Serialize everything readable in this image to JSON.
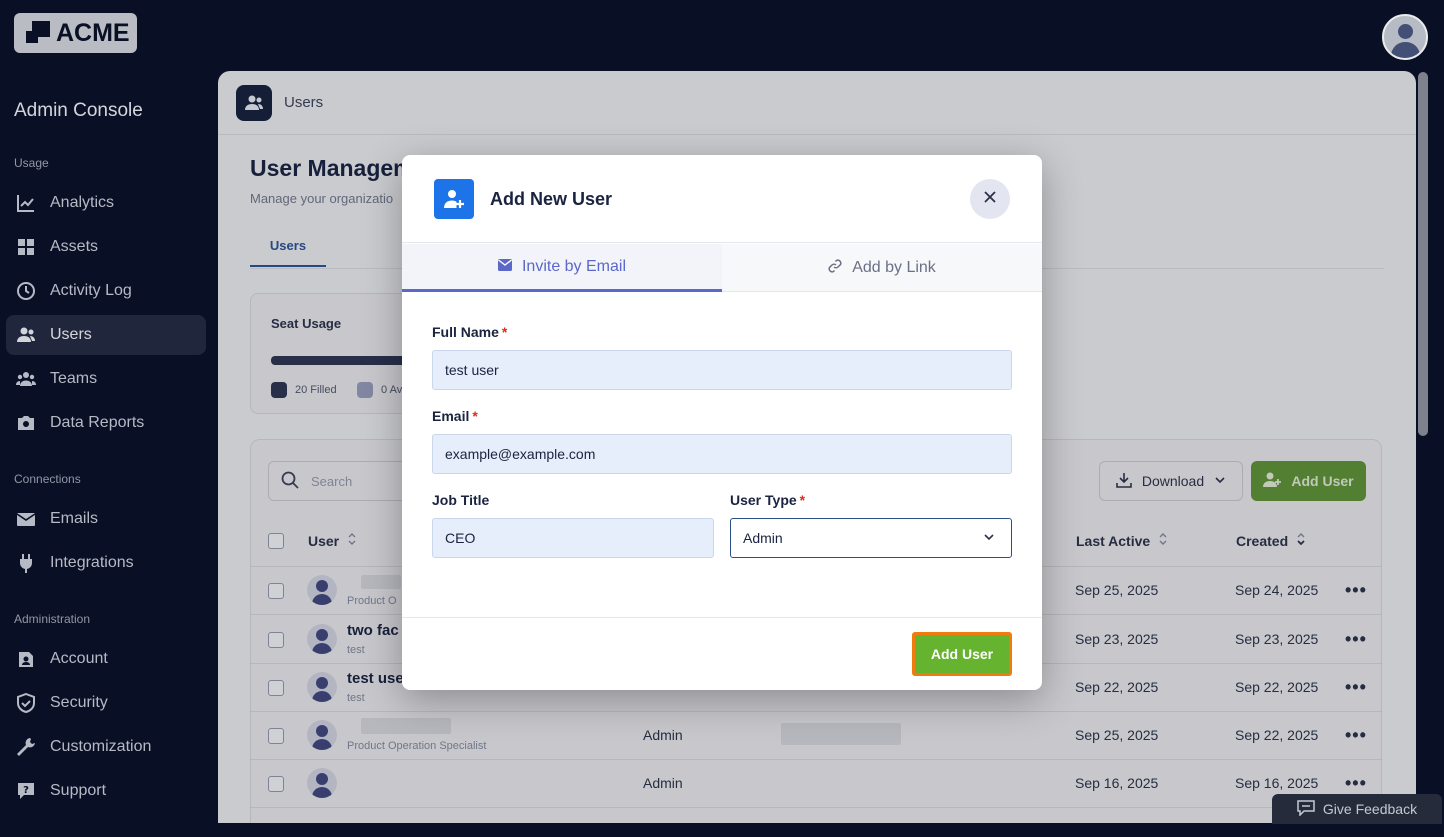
{
  "brand": {
    "logo_text": "ACME"
  },
  "sidebar": {
    "title": "Admin Console",
    "sections": [
      {
        "label": "Usage"
      },
      {
        "label": "Connections"
      },
      {
        "label": "Administration"
      }
    ],
    "items": [
      {
        "label": "Analytics",
        "icon": "analytics-icon"
      },
      {
        "label": "Assets",
        "icon": "assets-icon"
      },
      {
        "label": "Activity Log",
        "icon": "clock-icon"
      },
      {
        "label": "Users",
        "icon": "users-icon",
        "active": true
      },
      {
        "label": "Teams",
        "icon": "teams-icon"
      },
      {
        "label": "Data Reports",
        "icon": "camera-icon"
      },
      {
        "label": "Emails",
        "icon": "mail-icon"
      },
      {
        "label": "Integrations",
        "icon": "plug-icon"
      },
      {
        "label": "Account",
        "icon": "account-icon"
      },
      {
        "label": "Security",
        "icon": "shield-icon"
      },
      {
        "label": "Customization",
        "icon": "wrench-icon"
      },
      {
        "label": "Support",
        "icon": "support-icon"
      }
    ]
  },
  "main": {
    "header_title": "Users",
    "page_title": "User Managem",
    "page_subtitle": "Manage your organizatio",
    "tab_users": "Users",
    "seat": {
      "label": "Seat Usage",
      "filled_label": "20 Filled",
      "available_label": "0 Av"
    },
    "table": {
      "search_placeholder": "Search",
      "download_label": "Download",
      "add_user_label": "Add User",
      "columns": {
        "user": "User",
        "last_active": "Last Active",
        "created": "Created"
      },
      "rows": [
        {
          "name": "",
          "sub": "Product O",
          "role": "",
          "last_active": "Sep 25, 2025",
          "created": "Sep 24, 2025"
        },
        {
          "name": "two fac",
          "sub": "test",
          "role": "",
          "last_active": "Sep 23, 2025",
          "created": "Sep 23, 2025"
        },
        {
          "name": "test use",
          "sub": "test",
          "role": "",
          "last_active": "Sep 22, 2025",
          "created": "Sep 22, 2025"
        },
        {
          "name": "",
          "sub": "Product Operation Specialist",
          "role": "Admin",
          "last_active": "Sep 25, 2025",
          "created": "Sep 22, 2025"
        },
        {
          "name": "",
          "sub": "",
          "role": "Admin",
          "last_active": "Sep 16, 2025",
          "created": "Sep 16, 2025"
        }
      ],
      "more_label": "•••"
    }
  },
  "feedback": {
    "label": "Give Feedback"
  },
  "modal": {
    "title": "Add New User",
    "tabs": [
      {
        "label": "Invite by Email",
        "active": true
      },
      {
        "label": "Add by Link",
        "active": false
      }
    ],
    "fields": {
      "full_name": {
        "label": "Full Name",
        "value": "test user",
        "required": "*"
      },
      "email": {
        "label": "Email",
        "value": "example@example.com",
        "required": "*"
      },
      "job_title": {
        "label": "Job Title",
        "value": "CEO"
      },
      "user_type": {
        "label": "User Type",
        "value": "Admin",
        "required": "*"
      }
    },
    "submit_label": "Add User"
  },
  "colors": {
    "primary_blue": "#1d73e8",
    "tab_active": "#5b67c9",
    "button_green": "#65b32e",
    "highlight_orange": "#f07c0e",
    "required_red": "#d92d20",
    "sidebar_bg": "#0a1128"
  }
}
